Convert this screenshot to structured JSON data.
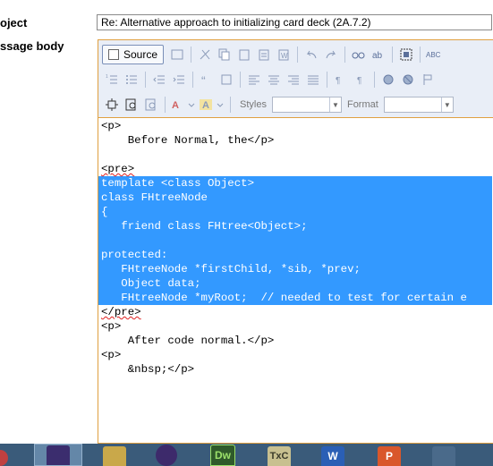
{
  "form": {
    "subject_label": "oject",
    "subject_value": "Re: Alternative approach to initializing card deck (2A.7.2)",
    "body_label": "ssage body"
  },
  "toolbar": {
    "source_label": "Source",
    "styles_label": "Styles",
    "format_label": "Format",
    "styles_value": "",
    "format_value": ""
  },
  "editor_lines": [
    "<p>",
    "    Before Normal, the</p>",
    "",
    "<pre>",
    "template <class Object>",
    "class FHtreeNode",
    "{",
    "   friend class FHtree<Object>;",
    "",
    "protected:",
    "   FHtreeNode *firstChild, *sib, *prev;",
    "   Object data;",
    "   FHtreeNode *myRoot;  // needed to test for certain e",
    "</pre>",
    "<p>",
    "    After code normal.</p>",
    "<p>",
    "    &nbsp;</p>"
  ],
  "taskbar": {
    "apps": [
      {
        "name": "visual-studio",
        "label": ""
      },
      {
        "name": "paint",
        "label": ""
      },
      {
        "name": "eclipse",
        "label": ""
      },
      {
        "name": "dreamweaver",
        "label": "Dw"
      },
      {
        "name": "textpad",
        "label": "TxC"
      },
      {
        "name": "word",
        "label": "W"
      },
      {
        "name": "powerpoint",
        "label": "P"
      },
      {
        "name": "security",
        "label": ""
      }
    ]
  },
  "colors": {
    "selection": "#3399ff",
    "editor_border": "#e0a040",
    "toolbar_bg": "#e9eef7",
    "taskbar_bg": "#3a5b7a"
  }
}
